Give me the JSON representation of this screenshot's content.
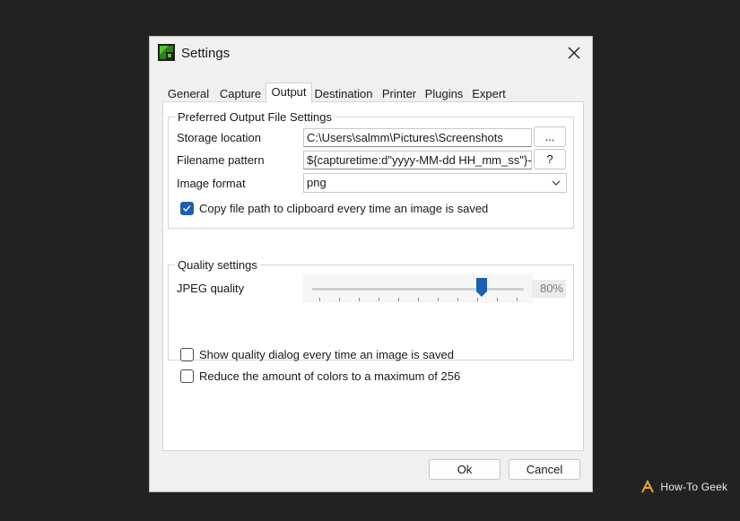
{
  "window": {
    "title": "Settings"
  },
  "tabs": [
    {
      "label": "General",
      "active": false
    },
    {
      "label": "Capture",
      "active": false
    },
    {
      "label": "Output",
      "active": true
    },
    {
      "label": "Destination",
      "active": false
    },
    {
      "label": "Printer",
      "active": false
    },
    {
      "label": "Plugins",
      "active": false
    },
    {
      "label": "Expert",
      "active": false
    }
  ],
  "output": {
    "group_title": "Preferred Output File Settings",
    "storage_label": "Storage location",
    "storage_value": "C:\\Users\\salmm\\Pictures\\Screenshots",
    "browse_label": "...",
    "filename_label": "Filename pattern",
    "filename_value": "${capturetime:d\"yyyy-MM-dd HH_mm_ss\"}-",
    "help_label": "?",
    "format_label": "Image format",
    "format_value": "png",
    "copy_path_label": "Copy file path to clipboard every time an image is saved",
    "copy_path_checked": true
  },
  "quality": {
    "group_title": "Quality settings",
    "jpeg_label": "JPEG quality",
    "jpeg_value": 80,
    "jpeg_value_text": "80%",
    "show_dialog_label": "Show quality dialog every time an image is saved",
    "show_dialog_checked": false,
    "reduce_colors_label": "Reduce the amount of colors to a maximum of 256",
    "reduce_colors_checked": false
  },
  "buttons": {
    "ok": "Ok",
    "cancel": "Cancel"
  },
  "watermark": {
    "text": "How-To Geek"
  },
  "colors": {
    "accent": "#1a5fb4",
    "desktop": "#222222",
    "window_bg": "#f0f0f0",
    "brand_orange": "#e8a33a"
  },
  "icons": {
    "app": "greenshot-icon",
    "close": "close-icon",
    "dropdown": "chevron-down-icon",
    "check": "check-icon",
    "watermark": "htg-logo-icon"
  }
}
